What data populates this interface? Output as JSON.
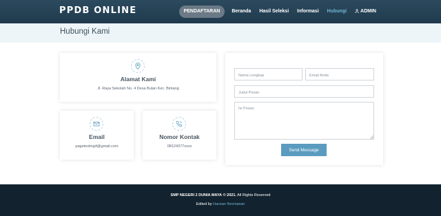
{
  "brand": "PPDB ONLINE",
  "nav": {
    "pendaftaran": "PENDAFTARAN",
    "beranda": "Beranda",
    "hasil_seleksi": "Hasil Seleksi",
    "informasi": "Informasi",
    "hubungi": "Hubungi",
    "admin": "ADMIN",
    "active_color": "#6fb3d2"
  },
  "page_title": "Hubungi Kami",
  "contact": {
    "address": {
      "title": "Alamat Kami",
      "text": "Jl. Raya Sekolah No. 4 Desa Bulan Kec. Bintang",
      "icon": "location-pin-icon"
    },
    "email": {
      "title": "Email",
      "text": "pagetesting4@gmail.com",
      "icon": "envelope-icon"
    },
    "phone": {
      "title": "Nomor Kontak",
      "text": "08124377xxxx",
      "icon": "phone-icon"
    }
  },
  "form": {
    "name_placeholder": "Nama Lengkap",
    "email_placeholder": "Email Anda",
    "subject_placeholder": "Judul Pesan",
    "message_placeholder": "Isi Pesan",
    "submit_label": "Send Message",
    "accent": "#5a9bbf"
  },
  "footer": {
    "school": "SMP NEGERI 2 DUNIA MAYA",
    "copyright": "© 2021.",
    "rights": "All Rights Reserved",
    "edited_by": "Edited by",
    "author": "Harwan Novriawan"
  }
}
